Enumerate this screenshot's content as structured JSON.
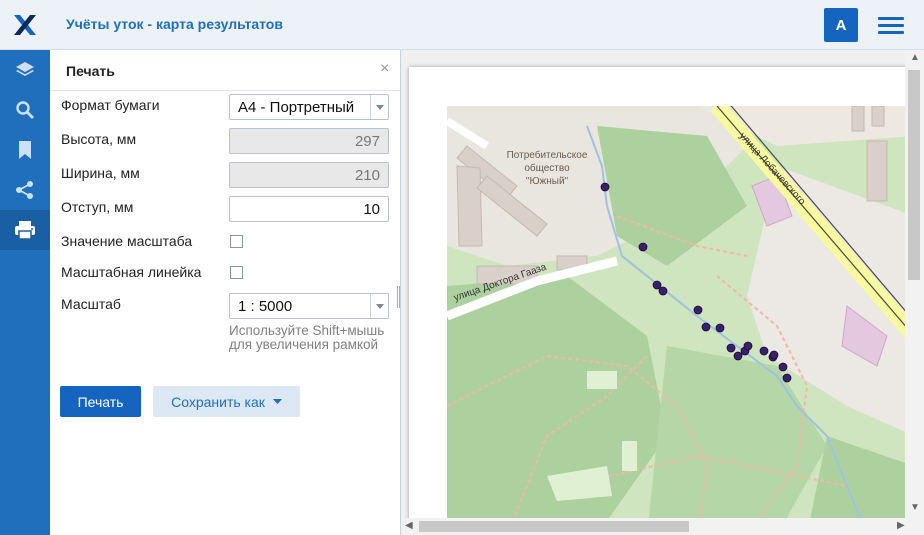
{
  "header": {
    "title": "Учёты уток - карта результатов",
    "user_initial": "A"
  },
  "rail": {
    "items": [
      {
        "icon": "layers-icon"
      },
      {
        "icon": "search-icon"
      },
      {
        "icon": "bookmark-icon"
      },
      {
        "icon": "share-icon"
      },
      {
        "icon": "printer-icon",
        "active": true
      }
    ]
  },
  "panel": {
    "title": "Печать",
    "close": "×",
    "fields": {
      "paper_format": {
        "label": "Формат бумаги",
        "value": "A4 - Портретный"
      },
      "height": {
        "label": "Высота, мм",
        "value": "297"
      },
      "width": {
        "label": "Ширина, мм",
        "value": "210"
      },
      "margin": {
        "label": "Отступ, мм",
        "value": "10"
      },
      "scale_value": {
        "label": "Значение масштаба",
        "checked": false
      },
      "scale_bar": {
        "label": "Масштабная линейка",
        "checked": false
      },
      "scale": {
        "label": "Масштаб",
        "value": "1 : 5000"
      }
    },
    "hint": "Используйте Shift+мышь для увеличения рамкой",
    "print_button": "Печать",
    "save_as_button": "Сохранить как"
  },
  "map": {
    "labels": {
      "cooperative": [
        "Потребительское",
        "общество",
        "\"Южный\""
      ],
      "street1": "улица Доктора Гааза",
      "street2": "улица Лобачевского"
    }
  },
  "colors": {
    "accent": "#1565c0",
    "rail": "#1f6fbd",
    "header_bg": "#edf2f9",
    "point": "#3b1f6b"
  }
}
